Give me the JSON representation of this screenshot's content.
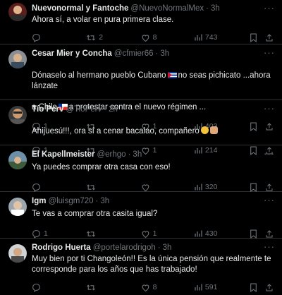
{
  "tweets": [
    {
      "name": "Nuevonormal y Fantoche",
      "handle": "@NuevoNormalMex",
      "sep": "·",
      "time": "3h",
      "text": "Ahora sí, a volar en pura primera clase.",
      "reply": "",
      "retweet": "2",
      "like": "8",
      "views": "743"
    },
    {
      "name": "Cesar Mier y Concha",
      "handle": "@cfmier66",
      "sep": "·",
      "time": "3h",
      "text_a": "Dónaselo al hermano pueblo Cubano",
      "text_b": "no seas pichicato ...ahora lánzate",
      "text_c": "a Chile",
      "text_d": "a protestar contra el nuevo régimen ...",
      "reply": "1",
      "retweet": "",
      "like": "1",
      "views": "403"
    },
    {
      "name": "Tío Perv",
      "handle": "@TioPerv",
      "sep": "·",
      "time": "2h",
      "text": "Ahijuesú!!!, ora sí a cenar bacalao, compañero",
      "reply": "1",
      "retweet": "",
      "like": "1",
      "views": "214"
    },
    {
      "name": "El Kapellmeister",
      "handle": "@erhgo",
      "sep": "·",
      "time": "3h",
      "text": "Ya puedes comprar otra casa con eso!",
      "reply": "",
      "retweet": "",
      "like": "",
      "views": "320"
    },
    {
      "name": "Igm",
      "handle": "@luisgm720",
      "sep": "·",
      "time": "3h",
      "text": "Te vas a comprar otra casita igual?",
      "reply": "1",
      "retweet": "",
      "like": "1",
      "views": "430"
    },
    {
      "name": "Rodrigo Huerta",
      "handle": "@portelarodrigoh",
      "sep": "·",
      "time": "3h",
      "text": "Muy bien por ti Changoleón!! Es la única pensión que realmente te\ncorresponde para los años que has trabajado!",
      "reply": "",
      "retweet": "",
      "like": "8",
      "views": "591"
    }
  ],
  "more_label": "···",
  "colors": {
    "background": "#000000",
    "text": "#e7e9ea",
    "muted": "#71767b",
    "divider": "#2f3336"
  }
}
